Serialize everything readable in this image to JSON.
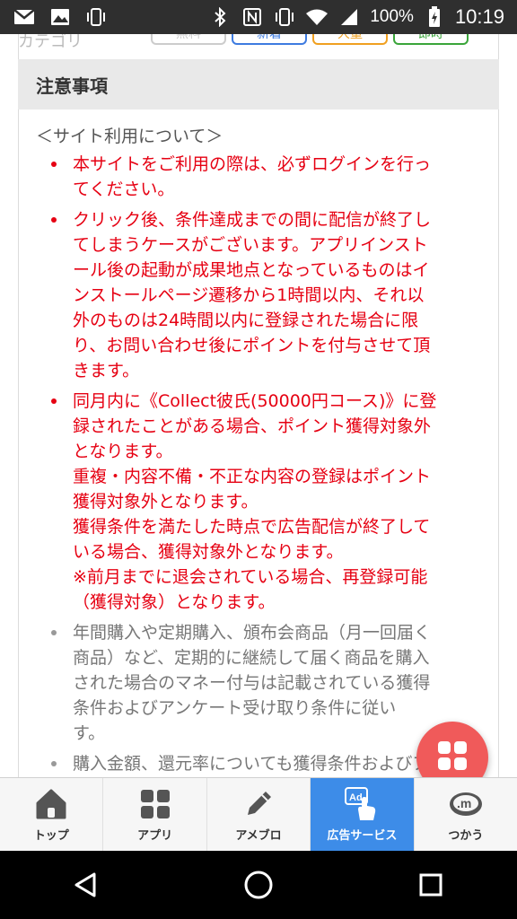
{
  "status_bar": {
    "battery": "100%",
    "time": "10:19",
    "icons": [
      "gmail-icon",
      "image-icon",
      "vibrate-icon",
      "bluetooth-icon",
      "nfc-icon",
      "vibrate-icon",
      "wifi-icon",
      "signal-icon",
      "battery-icon"
    ]
  },
  "category": {
    "label": "カテゴリ",
    "chips": [
      {
        "label": "無料",
        "color": "#cccccc"
      },
      {
        "label": "新着",
        "color": "#3d7be0"
      },
      {
        "label": "大量",
        "color": "#f0a020"
      },
      {
        "label": "即時",
        "color": "#3aa53a"
      }
    ]
  },
  "notice": {
    "header": "注意事項",
    "section_title": "＜サイト利用について＞",
    "items": [
      {
        "lines": [
          "本サイトをご利用の際は、必ずログインを行っ",
          "てください。"
        ]
      },
      {
        "lines": [
          "クリック後、条件達成までの間に配信が終了し",
          "てしまうケースがございます。アプリインスト",
          "ール後の起動が成果地点となっているものはイ",
          "ンストールページ遷移から1時間以内、それ以",
          "外のものは24時間以内に登録された場合に限",
          "り、お問い合わせ後にポイントを付与させて頂",
          "きます。"
        ]
      },
      {
        "lines": [
          "同月内に《Collect彼氏(50000円コース)》に登",
          "録されたことがある場合、ポイント獲得対象外",
          "となります。",
          "重複・内容不備・不正な内容の登録はポイント",
          "獲得対象外となります。",
          "獲得条件を満たした時点で広告配信が終了して",
          "いる場合、獲得対象外となります。",
          "※前月までに退会されている場合、再登録可能",
          "（獲得対象）となります。"
        ]
      },
      {
        "lines": [
          "年間購入や定期購入、頒布会商品（月一回届く",
          "商品）など、定期的に継続して届く商品を購入",
          "された場合のマネー付与は記載されている獲得",
          "条件およびアンケート受け取り条件に従い",
          "す。"
        ]
      },
      {
        "lines": [
          "購入金額、還元率についても獲得条件およびア"
        ]
      }
    ]
  },
  "fab": {
    "icon": "grid-menu-icon"
  },
  "tabs": [
    {
      "label": "トップ",
      "icon": "home-icon",
      "active": false
    },
    {
      "label": "アプリ",
      "icon": "apps-grid-icon",
      "active": false
    },
    {
      "label": "アメブロ",
      "icon": "pencil-icon",
      "active": false
    },
    {
      "label": "広告サービス",
      "icon": "ad-tap-icon",
      "active": true
    },
    {
      "label": "つかう",
      "icon": "money-icon",
      "active": false
    }
  ],
  "colors": {
    "accent_red": "#e60012",
    "tab_active": "#3d8ce8",
    "fab": "#f05a5a"
  }
}
